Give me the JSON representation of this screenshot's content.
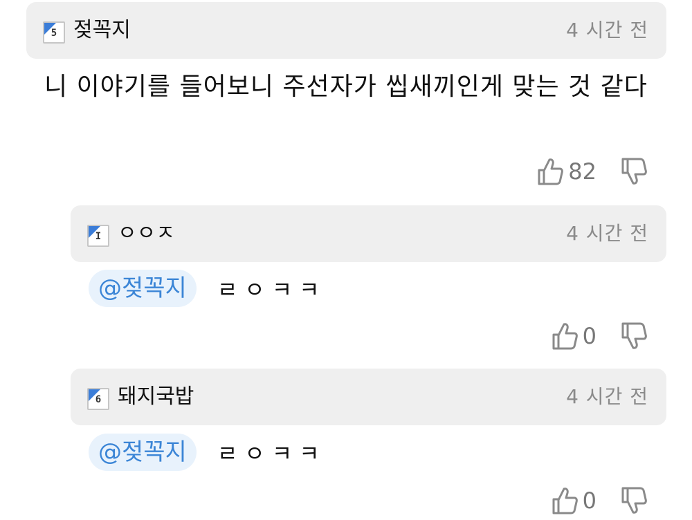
{
  "comments": [
    {
      "level": "5",
      "username": "젖꼭지",
      "time": "4 시간 전",
      "body": "니 이야기를 들어보니 주선자가 씹새끼인게 맞는 것 같다",
      "likes": "82"
    },
    {
      "level": "I",
      "username": "ㅇㅇㅈ",
      "time": "4 시간 전",
      "mention": "@젖꼭지",
      "body": "ㄹㅇㅋㅋ",
      "likes": "0"
    },
    {
      "level": "6",
      "username": "돼지국밥",
      "time": "4 시간 전",
      "mention": "@젖꼭지",
      "body": "ㄹㅇㅋㅋ",
      "likes": "0"
    }
  ],
  "icons": {
    "like": "thumbs-up-icon",
    "dislike": "thumbs-down-icon"
  },
  "colors": {
    "header_bg": "#efefef",
    "mention_bg": "#e8f2fc",
    "mention_text": "#3b85d6",
    "timestamp": "#8a8a8a",
    "badge_accent": "#3b7dd8"
  }
}
